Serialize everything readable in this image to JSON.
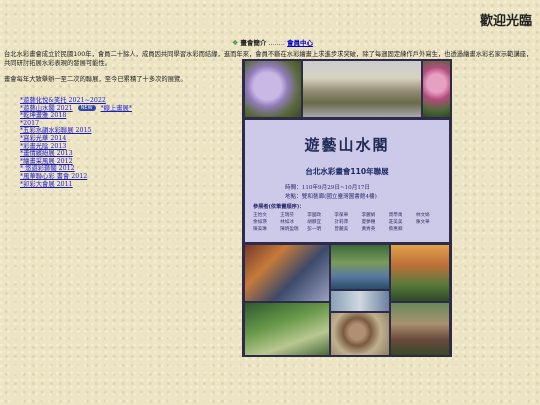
{
  "header": {
    "welcome": "歡迎光臨"
  },
  "topnav": {
    "bullet": "❖",
    "intro_label": "畫會簡介",
    "separator": "........",
    "member_center": "會員中心"
  },
  "intro": {
    "para1": "台北水彩畫會成立於民國100年，會員二十餘人，成員因共同學習水彩而結緣，進而年來，會員不斷在水彩繪畫上求進步求突破，除了每週固定練作戶外寫生，也透過繪畫水彩名家示範講座，共同研討拓展水彩表現的發展可能性。",
    "para2": "畫會每年大致舉辦一至二次的聯展，至今已累積了十多次的展覽。"
  },
  "exhibitions": [
    {
      "label": "*遊藝化悅&笑托 2021~2022"
    },
    {
      "label": "*遊藝山水閣 2021",
      "badge": "NEW",
      "extra": "*線上畫展*"
    },
    {
      "label": "*乾坤畫雅 2018"
    },
    {
      "label": "*2017"
    },
    {
      "label": "*五彩水韻水彩聯展 2015"
    },
    {
      "label": "*寫彩光華 2014"
    },
    {
      "label": "*彩畫光陰 2013"
    },
    {
      "label": "*畫情繽紛展 2013"
    },
    {
      "label": "*繪畫采風展 2012"
    },
    {
      "label": "* 悠遊彩藝閣 2012"
    },
    {
      "label": "*風華聯心彩 書會 2012"
    },
    {
      "label": "*卯彩大會展 2011"
    }
  ],
  "poster": {
    "title": "遊藝山水閣",
    "subtitle": "台北水彩畫會110年聯展",
    "info": "時間：110年9月29日~10月17日\n地點：雙和藝廊(國立臺灣圖書館4樓)",
    "exhibitors_label": "參展者(依筆畫順序)：",
    "exhibitors": [
      "王怡文",
      "王瑞芬",
      "李國政",
      "李葆華",
      "李麗娟",
      "周學禹",
      "林文娟",
      "余如瑛",
      "林如冰",
      "胡靜宜",
      "計莉萍",
      "夏夢穗",
      "莊美美",
      "陳文華",
      "陳美琳",
      "陳炳盈瑞",
      "彭一明",
      "曾麗美",
      "黃秀英",
      "蔡惠卿"
    ]
  }
}
